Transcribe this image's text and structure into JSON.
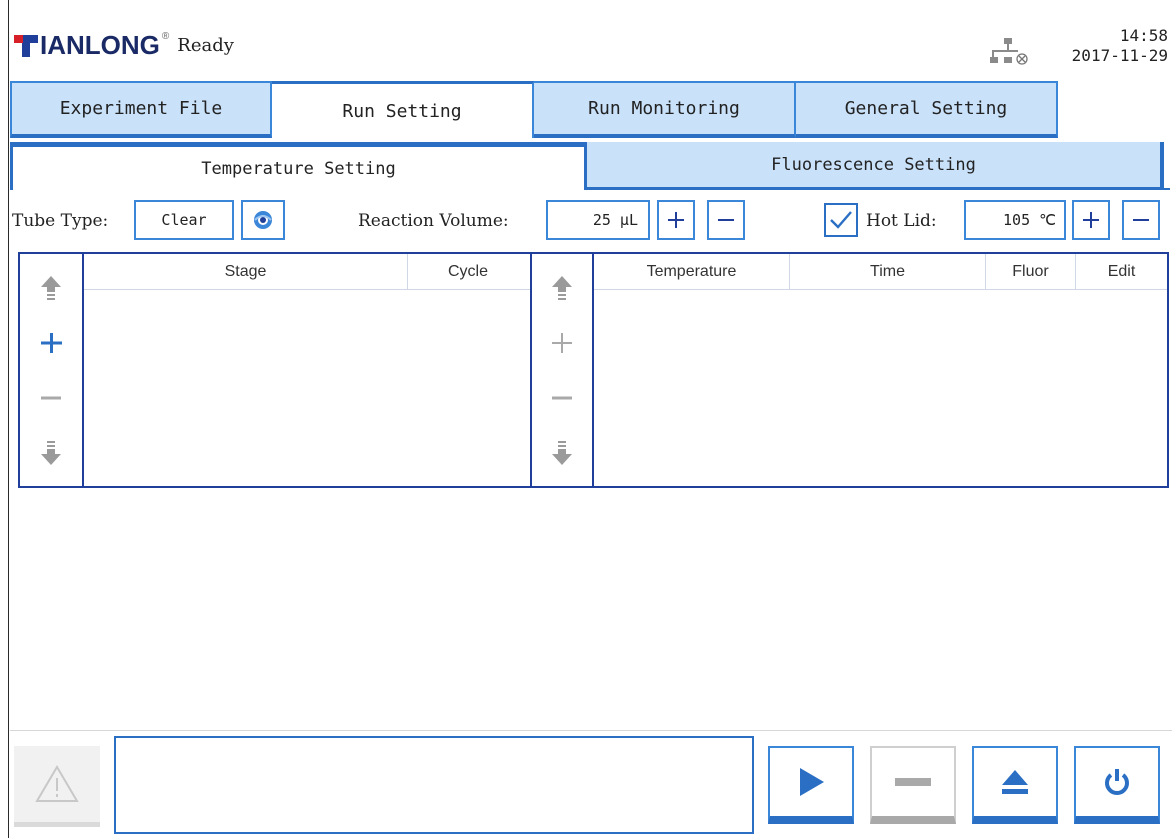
{
  "header": {
    "brand": "IANLONG",
    "status": "Ready",
    "time": "14:58",
    "date": "2017-11-29"
  },
  "main_tabs": [
    {
      "label": "Experiment File",
      "active": false
    },
    {
      "label": "Run Setting",
      "active": true
    },
    {
      "label": "Run Monitoring",
      "active": false
    },
    {
      "label": "General Setting",
      "active": false
    }
  ],
  "sub_tabs": [
    {
      "label": "Temperature Setting",
      "active": true
    },
    {
      "label": "Fluorescence Setting",
      "active": false
    }
  ],
  "settings": {
    "tube_type_label": "Tube Type:",
    "tube_type_value": "Clear",
    "reaction_volume_label": "Reaction Volume:",
    "reaction_volume_value": "25 μL",
    "hot_lid_checked": true,
    "hot_lid_label": "Hot Lid:",
    "hot_lid_value": "105 ℃"
  },
  "stage_table": {
    "columns": [
      "Stage",
      "Cycle"
    ],
    "rows": []
  },
  "step_table": {
    "columns": [
      "Temperature",
      "Time",
      "Fluor",
      "Edit"
    ],
    "rows": []
  },
  "message": "",
  "colors": {
    "accent": "#2a6fc4",
    "tab_bg": "#c9e1f9",
    "brand_red": "#d61f26",
    "brand_blue": "#1f3f9a"
  }
}
